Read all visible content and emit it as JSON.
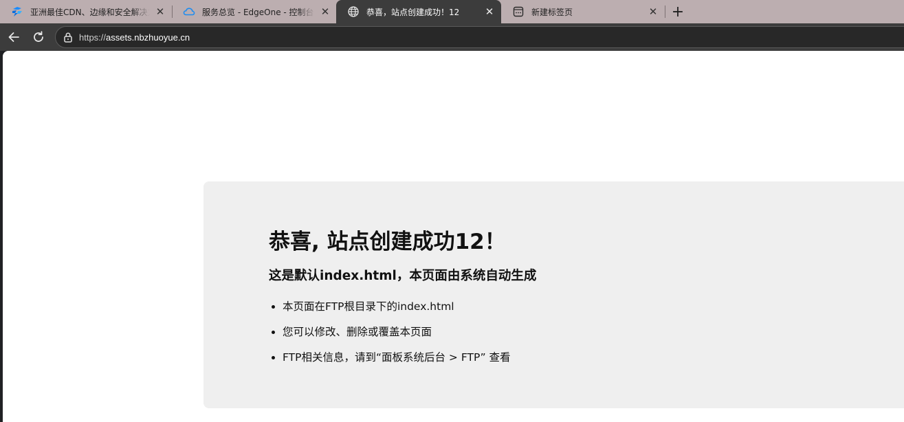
{
  "browser": {
    "tabs": [
      {
        "title": "亚洲最佳CDN、边缘和安全解决方案",
        "favicon": "edgeone-logo-icon",
        "active": false
      },
      {
        "title": "服务总览 - EdgeOne - 控制台",
        "favicon": "cloud-icon",
        "active": false
      },
      {
        "title": "恭喜，站点创建成功！12",
        "favicon": "globe-icon",
        "active": true
      },
      {
        "title": "新建标签页",
        "favicon": "new-tab-page-icon",
        "active": false
      }
    ],
    "new_tab_symbol": "+",
    "close_symbol": "✕",
    "address": {
      "scheme": "https://",
      "host": "assets.nbzhuoyue.cn"
    }
  },
  "page": {
    "heading": "恭喜, 站点创建成功12！",
    "subheading": "这是默认index.html，本页面由系统自动生成",
    "items": [
      "本页面在FTP根目录下的index.html",
      "您可以修改、删除或覆盖本页面",
      "FTP相关信息，请到“面板系统后台 > FTP” 查看"
    ]
  },
  "colors": {
    "tabstrip": "#bcaeb0",
    "toolbar": "#3c3c3c",
    "card": "#efefef"
  }
}
